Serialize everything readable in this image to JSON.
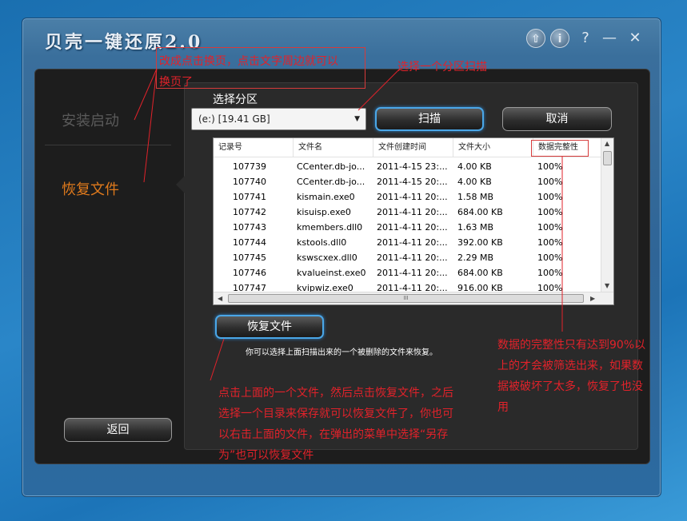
{
  "window": {
    "title": "贝壳一键还原2.0",
    "controls": {
      "up": "⇧",
      "info": "i",
      "help": "?",
      "minimize": "—",
      "close": "✕"
    }
  },
  "sidebar": {
    "items": [
      {
        "label": "安装启动",
        "color": "#5a5a5a"
      },
      {
        "label": "恢复文件",
        "color": "#e07a1c"
      }
    ],
    "back_button": "返回"
  },
  "main": {
    "select_label": "选择分区",
    "partition_value": "(e:) [19.41 GB]",
    "scan_button": "扫描",
    "cancel_button": "取消",
    "restore_button": "恢复文件",
    "hint": "你可以选择上面扫描出来的一个被删除的文件来恢复。",
    "table": {
      "columns": [
        "记录号",
        "文件名",
        "文件创建时间",
        "文件大小",
        "数据完整性"
      ],
      "rows": [
        [
          "107739",
          "CCenter.db-jo...",
          "2011-4-15 23:...",
          "4.00 KB",
          "100%"
        ],
        [
          "107740",
          "CCenter.db-jo...",
          "2011-4-15 20:...",
          "4.00 KB",
          "100%"
        ],
        [
          "107741",
          "kismain.exe0",
          "2011-4-11 20:...",
          "1.58 MB",
          "100%"
        ],
        [
          "107742",
          "kisuisp.exe0",
          "2011-4-11 20:...",
          "684.00 KB",
          "100%"
        ],
        [
          "107743",
          "kmembers.dll0",
          "2011-4-11 20:...",
          "1.63 MB",
          "100%"
        ],
        [
          "107744",
          "kstools.dll0",
          "2011-4-11 20:...",
          "392.00 KB",
          "100%"
        ],
        [
          "107745",
          "kswscxex.dll0",
          "2011-4-11 20:...",
          "2.29 MB",
          "100%"
        ],
        [
          "107746",
          "kvalueinst.exe0",
          "2011-4-11 20:...",
          "684.00 KB",
          "100%"
        ],
        [
          "107747",
          "kvipwiz.exe0",
          "2011-4-11 20:...",
          "916.00 KB",
          "100%"
        ]
      ],
      "hscroll_grip": "III"
    }
  },
  "annotations": {
    "tab_note": [
      "改成点击换页，点击文字周边就可以",
      "换页了"
    ],
    "scan_note": "选择一个分区扫描",
    "integrity_note": [
      "数据的完整性只有达到90%以",
      "上的才会被筛选出来，如果数",
      "据被破坏了太多，恢复了也没",
      "用"
    ],
    "restore_note": [
      "点击上面的一个文件，然后点击恢复文件，之后",
      "选择一个目录来保存就可以恢复文件了，你也可",
      "以右击上面的文件，在弹出的菜单中选择“另存",
      "为”也可以恢复文件"
    ]
  },
  "colors": {
    "annotation": "#e2222a",
    "active_tab": "#e07a1c",
    "accent_blue": "#4aa7e8"
  }
}
